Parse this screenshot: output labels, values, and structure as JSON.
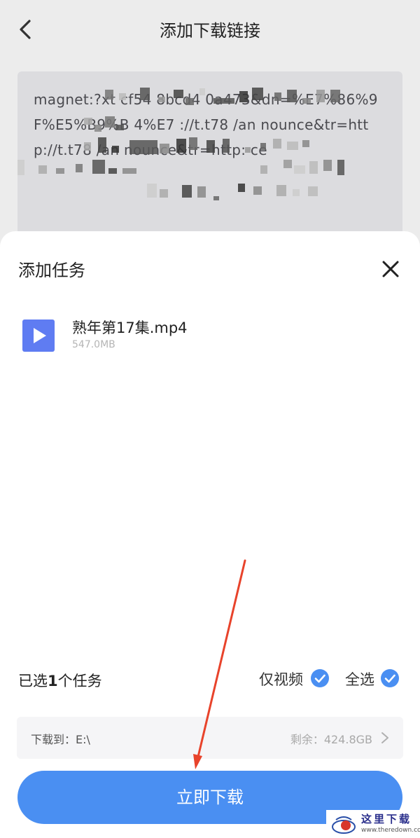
{
  "header": {
    "title": "添加下载链接",
    "back_icon": "chevron-left-icon"
  },
  "link_box": {
    "text": "magnet:?xt cf54 8bcd4 0a473&dn=%E7%86%9F%E5%B9%B 4%E7 ://t.t78 /an nounce&tr=http://t.t78 /an nounce&tr=http: ce"
  },
  "sheet": {
    "title": "添加任务",
    "close_icon": "close-icon"
  },
  "file": {
    "icon": "video-file-icon",
    "name": "熟年第17集.mp4",
    "size": "547.0MB",
    "icon_color": "#5f7cf2"
  },
  "selection": {
    "prefix": "已选",
    "count": "1",
    "suffix": "个任务",
    "video_only_label": "仅视频",
    "video_only_checked": true,
    "select_all_label": "全选",
    "select_all_checked": true,
    "check_color": "#4a8ff2"
  },
  "path": {
    "label": "下载到：E:\\",
    "remaining": "剩余：424.8GB",
    "chevron": "chevron-right-icon"
  },
  "download_button": {
    "label": "立即下载",
    "color": "#4a8ff2"
  },
  "annotation": {
    "arrow_color": "#e8432b"
  },
  "watermark": {
    "name": "这里下载",
    "url": "www.theredown.com"
  }
}
